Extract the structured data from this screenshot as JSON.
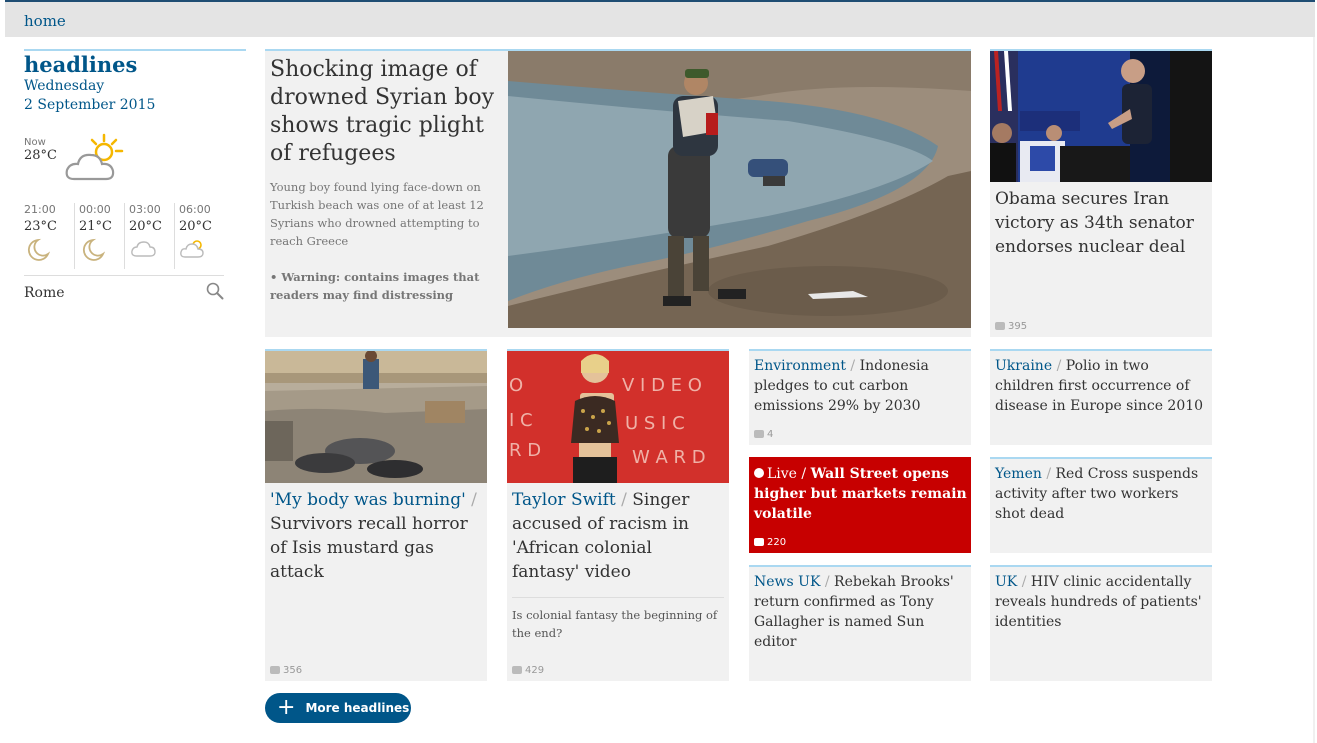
{
  "nav": {
    "home": "home"
  },
  "left": {
    "title": "headlines",
    "day": "Wednesday",
    "date": "2 September 2015",
    "weather": {
      "now_label": "Now",
      "now_temp": "28°C",
      "forecast": [
        {
          "time": "21:00",
          "temp": "23°C",
          "icon": "moon-icon"
        },
        {
          "time": "00:00",
          "temp": "21°C",
          "icon": "moon-icon"
        },
        {
          "time": "03:00",
          "temp": "20°C",
          "icon": "cloud-night-icon"
        },
        {
          "time": "06:00",
          "temp": "20°C",
          "icon": "cloud-sun-icon"
        }
      ],
      "location": "Rome"
    }
  },
  "lead": {
    "title": "Shocking image of drowned Syrian boy shows tragic plight of refugees",
    "standfirst": "Young boy found lying face-down on Turkish beach was one of at least 12 Syrians who drowned attempting to reach Greece",
    "warning": "• Warning: contains images that readers may find distressing"
  },
  "obama": {
    "title": "Obama secures Iran victory as 34th senator endorses nuclear deal",
    "comments": "395"
  },
  "isis": {
    "kicker": "'My body was burning'",
    "title": "Survivors recall horror of Isis mustard gas attack",
    "comments": "356"
  },
  "swift": {
    "kicker": "Taylor Swift",
    "title": "Singer accused of racism in 'African colonial fantasy' video",
    "sub": "Is colonial fantasy the beginning of the end?",
    "comments": "429"
  },
  "env": {
    "kicker": "Environment",
    "title": "Indonesia pledges to cut carbon emissions 29% by 2030",
    "comments": "4"
  },
  "live": {
    "live": "Live",
    "title": "Wall Street opens higher but markets remain volatile",
    "comments": "220"
  },
  "newsuk": {
    "kicker": "News UK",
    "title": "Rebekah Brooks' return confirmed as Tony Gallagher is named Sun editor"
  },
  "ukraine": {
    "kicker": "Ukraine",
    "title": "Polio in two children first occurrence of disease in Europe since 2010"
  },
  "yemen": {
    "kicker": "Yemen",
    "title": "Red Cross suspends activity after two workers shot dead"
  },
  "uk": {
    "kicker": "UK",
    "title": "HIV clinic accidentally reveals hundreds of patients' identities"
  },
  "more": {
    "label": "More headlines"
  },
  "colors": {
    "brand": "#005689",
    "live": "#c70000",
    "rule": "#aad8f1",
    "card": "#f1f1f1"
  }
}
